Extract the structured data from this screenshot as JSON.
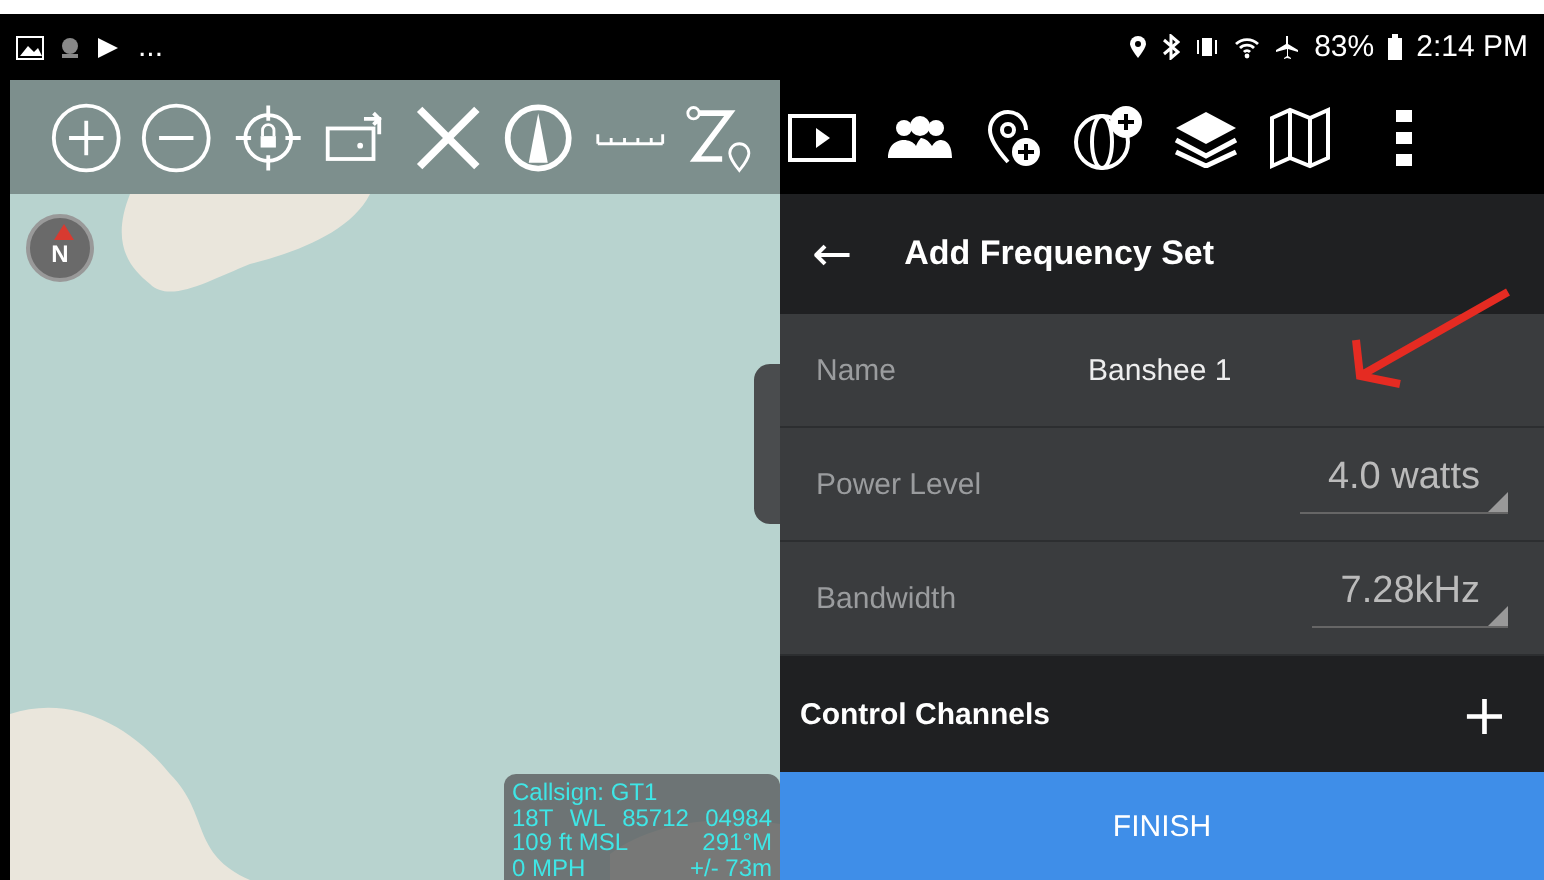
{
  "status_bar": {
    "overflow": "...",
    "battery": "83%",
    "time": "2:14 PM"
  },
  "map": {
    "compass": "N",
    "info": [
      "Callsign: GT1",
      [
        "18T",
        "WL",
        "85712",
        "04984"
      ],
      [
        "109 ft MSL",
        "291°M"
      ],
      [
        "0 MPH",
        "+/- 73m"
      ]
    ]
  },
  "panel": {
    "back": "←",
    "title": "Add Frequency Set",
    "fields": [
      {
        "kind": "text",
        "label": "Name",
        "value": "Banshee 1"
      },
      {
        "kind": "dropdown",
        "label": "Power Level",
        "value": "4.0 watts"
      },
      {
        "kind": "dropdown",
        "label": "Bandwidth",
        "value": "7.28kHz"
      }
    ],
    "section": {
      "label": "Control Channels",
      "action": "+"
    },
    "finish": "FINISH"
  }
}
